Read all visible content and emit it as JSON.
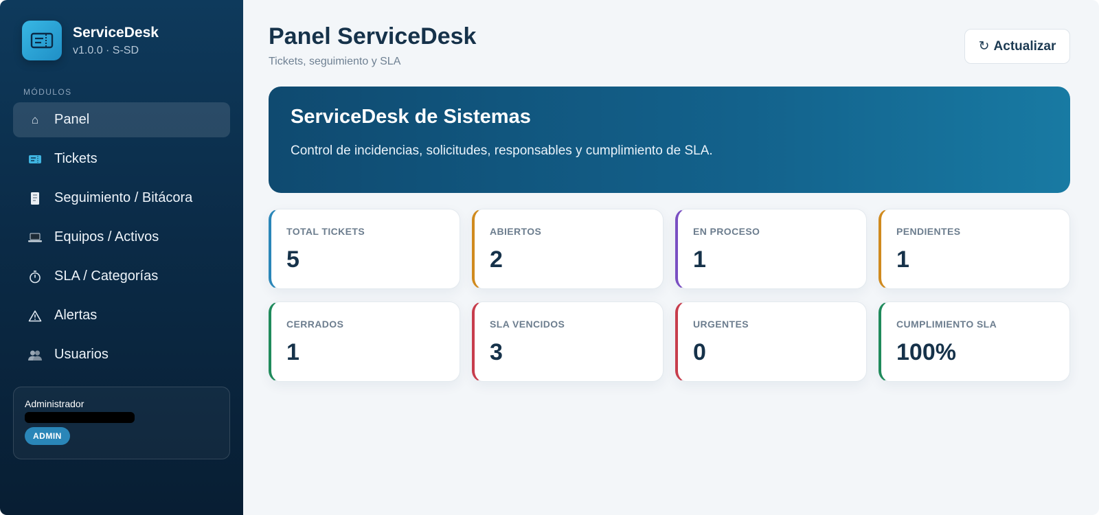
{
  "brand": {
    "name": "ServiceDesk",
    "version": "v1.0.0 · S-SD"
  },
  "sidebar": {
    "section_label": "MÓDULOS",
    "items": [
      {
        "label": "Panel",
        "icon": "home-icon",
        "active": true
      },
      {
        "label": "Tickets",
        "icon": "ticket-icon"
      },
      {
        "label": "Seguimiento / Bitácora",
        "icon": "log-icon"
      },
      {
        "label": "Equipos / Activos",
        "icon": "laptop-icon"
      },
      {
        "label": "SLA / Categorías",
        "icon": "stopwatch-icon"
      },
      {
        "label": "Alertas",
        "icon": "warning-icon"
      },
      {
        "label": "Usuarios",
        "icon": "users-icon"
      }
    ]
  },
  "user": {
    "name": "Administrador",
    "role": "ADMIN"
  },
  "header": {
    "title": "Panel ServiceDesk",
    "subtitle": "Tickets, seguimiento y SLA",
    "refresh_label": "Actualizar"
  },
  "hero": {
    "title": "ServiceDesk de Sistemas",
    "description": "Control de incidencias, solicitudes, responsables y cumplimiento de SLA."
  },
  "stats": [
    {
      "label": "TOTAL TICKETS",
      "value": "5",
      "color": "#2a86b8"
    },
    {
      "label": "ABIERTOS",
      "value": "2",
      "color": "#d08a1e"
    },
    {
      "label": "EN PROCESO",
      "value": "1",
      "color": "#7a4fc2"
    },
    {
      "label": "PENDIENTES",
      "value": "1",
      "color": "#d08a1e"
    },
    {
      "label": "CERRADOS",
      "value": "1",
      "color": "#1f8a5b"
    },
    {
      "label": "SLA VENCIDOS",
      "value": "3",
      "color": "#c73d4c"
    },
    {
      "label": "URGENTES",
      "value": "0",
      "color": "#c73d4c"
    },
    {
      "label": "CUMPLIMIENTO SLA",
      "value": "100%",
      "color": "#1f8a5b"
    }
  ],
  "colors": {
    "sidebar_bg": "#0b2b47",
    "accent": "#2a86b8",
    "main_bg": "#f3f6f9",
    "hero_bg": "#13628c"
  }
}
